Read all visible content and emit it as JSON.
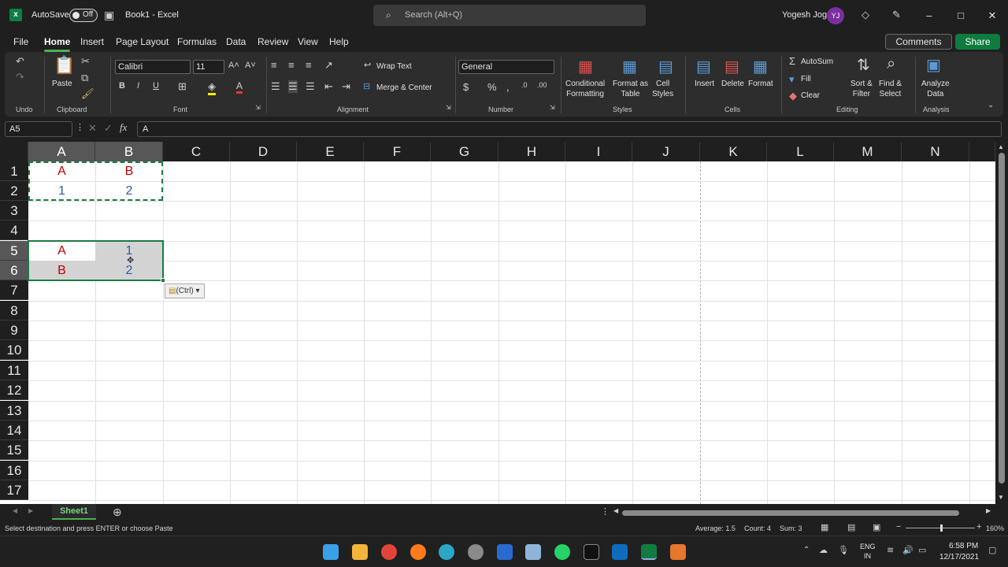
{
  "titlebar": {
    "autosave_label": "AutoSave",
    "autosave_state": "Off",
    "doc_title": "Book1  -  Excel",
    "search_placeholder": "Search (Alt+Q)",
    "user_name": "Yogesh Jog",
    "user_initials": "YJ"
  },
  "menu": {
    "items": [
      "File",
      "Home",
      "Insert",
      "Page Layout",
      "Formulas",
      "Data",
      "Review",
      "View",
      "Help"
    ],
    "active": "Home",
    "comments_label": "Comments",
    "share_label": "Share"
  },
  "ribbon": {
    "groups": {
      "undo": "Undo",
      "clipboard": "Clipboard",
      "font": "Font",
      "alignment": "Alignment",
      "number": "Number",
      "styles": "Styles",
      "cells": "Cells",
      "editing": "Editing",
      "analysis": "Analysis"
    },
    "paste_label": "Paste",
    "font_name": "Calibri",
    "font_size": "11",
    "wrap_text": "Wrap Text",
    "merge_center": "Merge & Center",
    "number_format": "General",
    "conditional_formatting": [
      "Conditional",
      "Formatting"
    ],
    "format_as_table": [
      "Format as",
      "Table"
    ],
    "cell_styles": [
      "Cell",
      "Styles"
    ],
    "insert": "Insert",
    "delete": "Delete",
    "format": "Format",
    "autosum": "AutoSum",
    "fill": "Fill",
    "clear": "Clear",
    "sort_filter": [
      "Sort &",
      "Filter"
    ],
    "find_select": [
      "Find &",
      "Select"
    ],
    "analyze_data": [
      "Analyze",
      "Data"
    ]
  },
  "formula_bar": {
    "name_box": "A5",
    "fx": "fx",
    "content": "A"
  },
  "grid": {
    "columns": [
      "A",
      "B",
      "C",
      "D",
      "E",
      "F",
      "G",
      "H",
      "I",
      "J",
      "K",
      "L",
      "M",
      "N"
    ],
    "rows": [
      "1",
      "2",
      "3",
      "4",
      "5",
      "6",
      "7",
      "8",
      "9",
      "10",
      "11",
      "12",
      "13",
      "14",
      "15",
      "16",
      "17"
    ],
    "cells": {
      "A1": "A",
      "B1": "B",
      "A2": "1",
      "B2": "2",
      "A5": "A",
      "B5": "1",
      "A6": "B",
      "B6": "2"
    },
    "paste_options": "(Ctrl)"
  },
  "sheets": {
    "tabs": [
      "Sheet1"
    ],
    "active": "Sheet1"
  },
  "status": {
    "message": "Select destination and press ENTER or choose Paste",
    "average": "Average: 1.5",
    "count": "Count: 4",
    "sum": "Sum: 3",
    "zoom": "160%"
  },
  "taskbar": {
    "lang1": "ENG",
    "lang2": "IN",
    "time": "6:58 PM",
    "date": "12/17/2021"
  },
  "colors": {
    "accent": "#107c41",
    "red_text": "#c00000",
    "blue_text": "#2e5aa8"
  }
}
